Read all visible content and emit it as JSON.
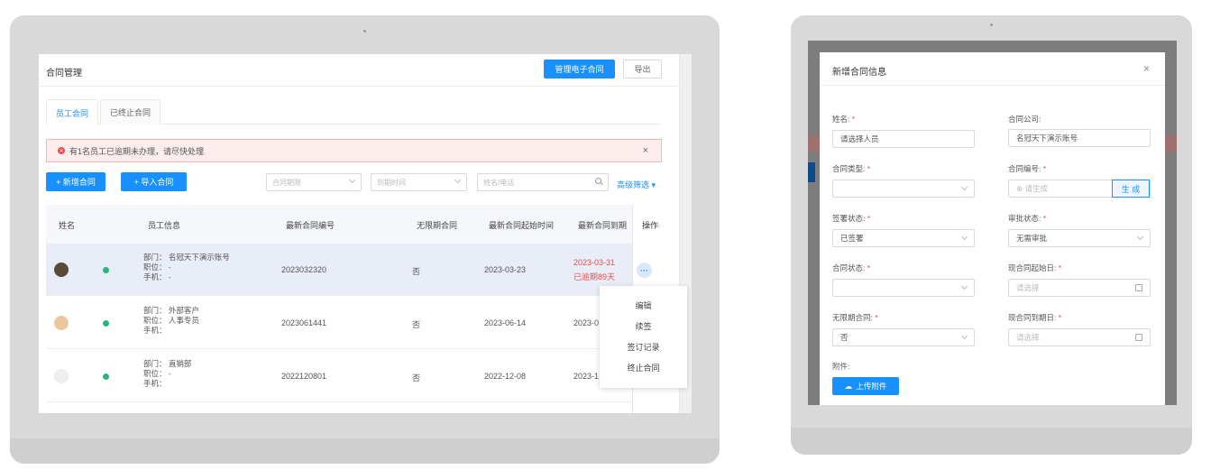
{
  "left": {
    "title": "合同管理",
    "btn_manage": "管理电子合同",
    "btn_export": "导出",
    "tabs": [
      "员工合同",
      "已终止合同"
    ],
    "alert": "有1名员工已逾期未办理，请尽快处理",
    "alert_close": "×",
    "btn_new": "+ 新增合同",
    "btn_import": "+ 导入合同",
    "filter_date": "合同期限",
    "filter_expire": "到期时间",
    "search_placeholder": "姓名/电话",
    "advanced": "高级筛选 ▾",
    "headers": [
      "姓名",
      "员工信息",
      "最新合同编号",
      "无限期合同",
      "最新合同起始时间",
      "最新合同到期",
      "操作"
    ],
    "rows": [
      {
        "dept": "部门： 名冠天下演示账号",
        "pos": "职位： -",
        "phone": "手机： -",
        "code": "2023032320",
        "unlimited": "否",
        "start": "2023-03-23",
        "end": "2023-03-31",
        "overdue": "已逾期89天"
      },
      {
        "dept": "部门： 外部客户",
        "pos": "职位： 人事专员",
        "phone": "手机：",
        "code": "2023061441",
        "unlimited": "否",
        "start": "2023-06-14",
        "end": "2023-0"
      },
      {
        "dept": "部门： 直销部",
        "pos": "职位： -",
        "phone": "手机：",
        "code": "2022120801",
        "unlimited": "否",
        "start": "2022-12-08",
        "end": "2023-1"
      }
    ],
    "more": "···",
    "menu": [
      "编辑",
      "续签",
      "签订记录",
      "终止合同"
    ],
    "colors": {
      "primary": "#1890ff",
      "danger": "#f04a4a",
      "success": "#2cb67d"
    }
  },
  "modal": {
    "title": "新增合同信息",
    "close": "×",
    "name_label": "姓名:",
    "name_placeholder": "请选择人员",
    "company_label": "合同公司:",
    "company_value": "名冠天下演示账号",
    "type_label": "合同类型:",
    "code_label": "合同编号:",
    "code_placeholder": "⊕ 请生成",
    "gen_btn": "生 成",
    "sign_label": "签署状态:",
    "sign_value": "已签署",
    "approve_label": "审批状态:",
    "approve_value": "无需审批",
    "status_label": "合同状态:",
    "start_label": "现合同起始日:",
    "start_placeholder": "请选择",
    "unlimited_label": "无限期合同:",
    "unlimited_value": "否",
    "end_label": "现合同到期日:",
    "end_placeholder": "请选择",
    "attach_label": "附件:",
    "upload_btn": "上传附件",
    "required_mark": "*"
  }
}
